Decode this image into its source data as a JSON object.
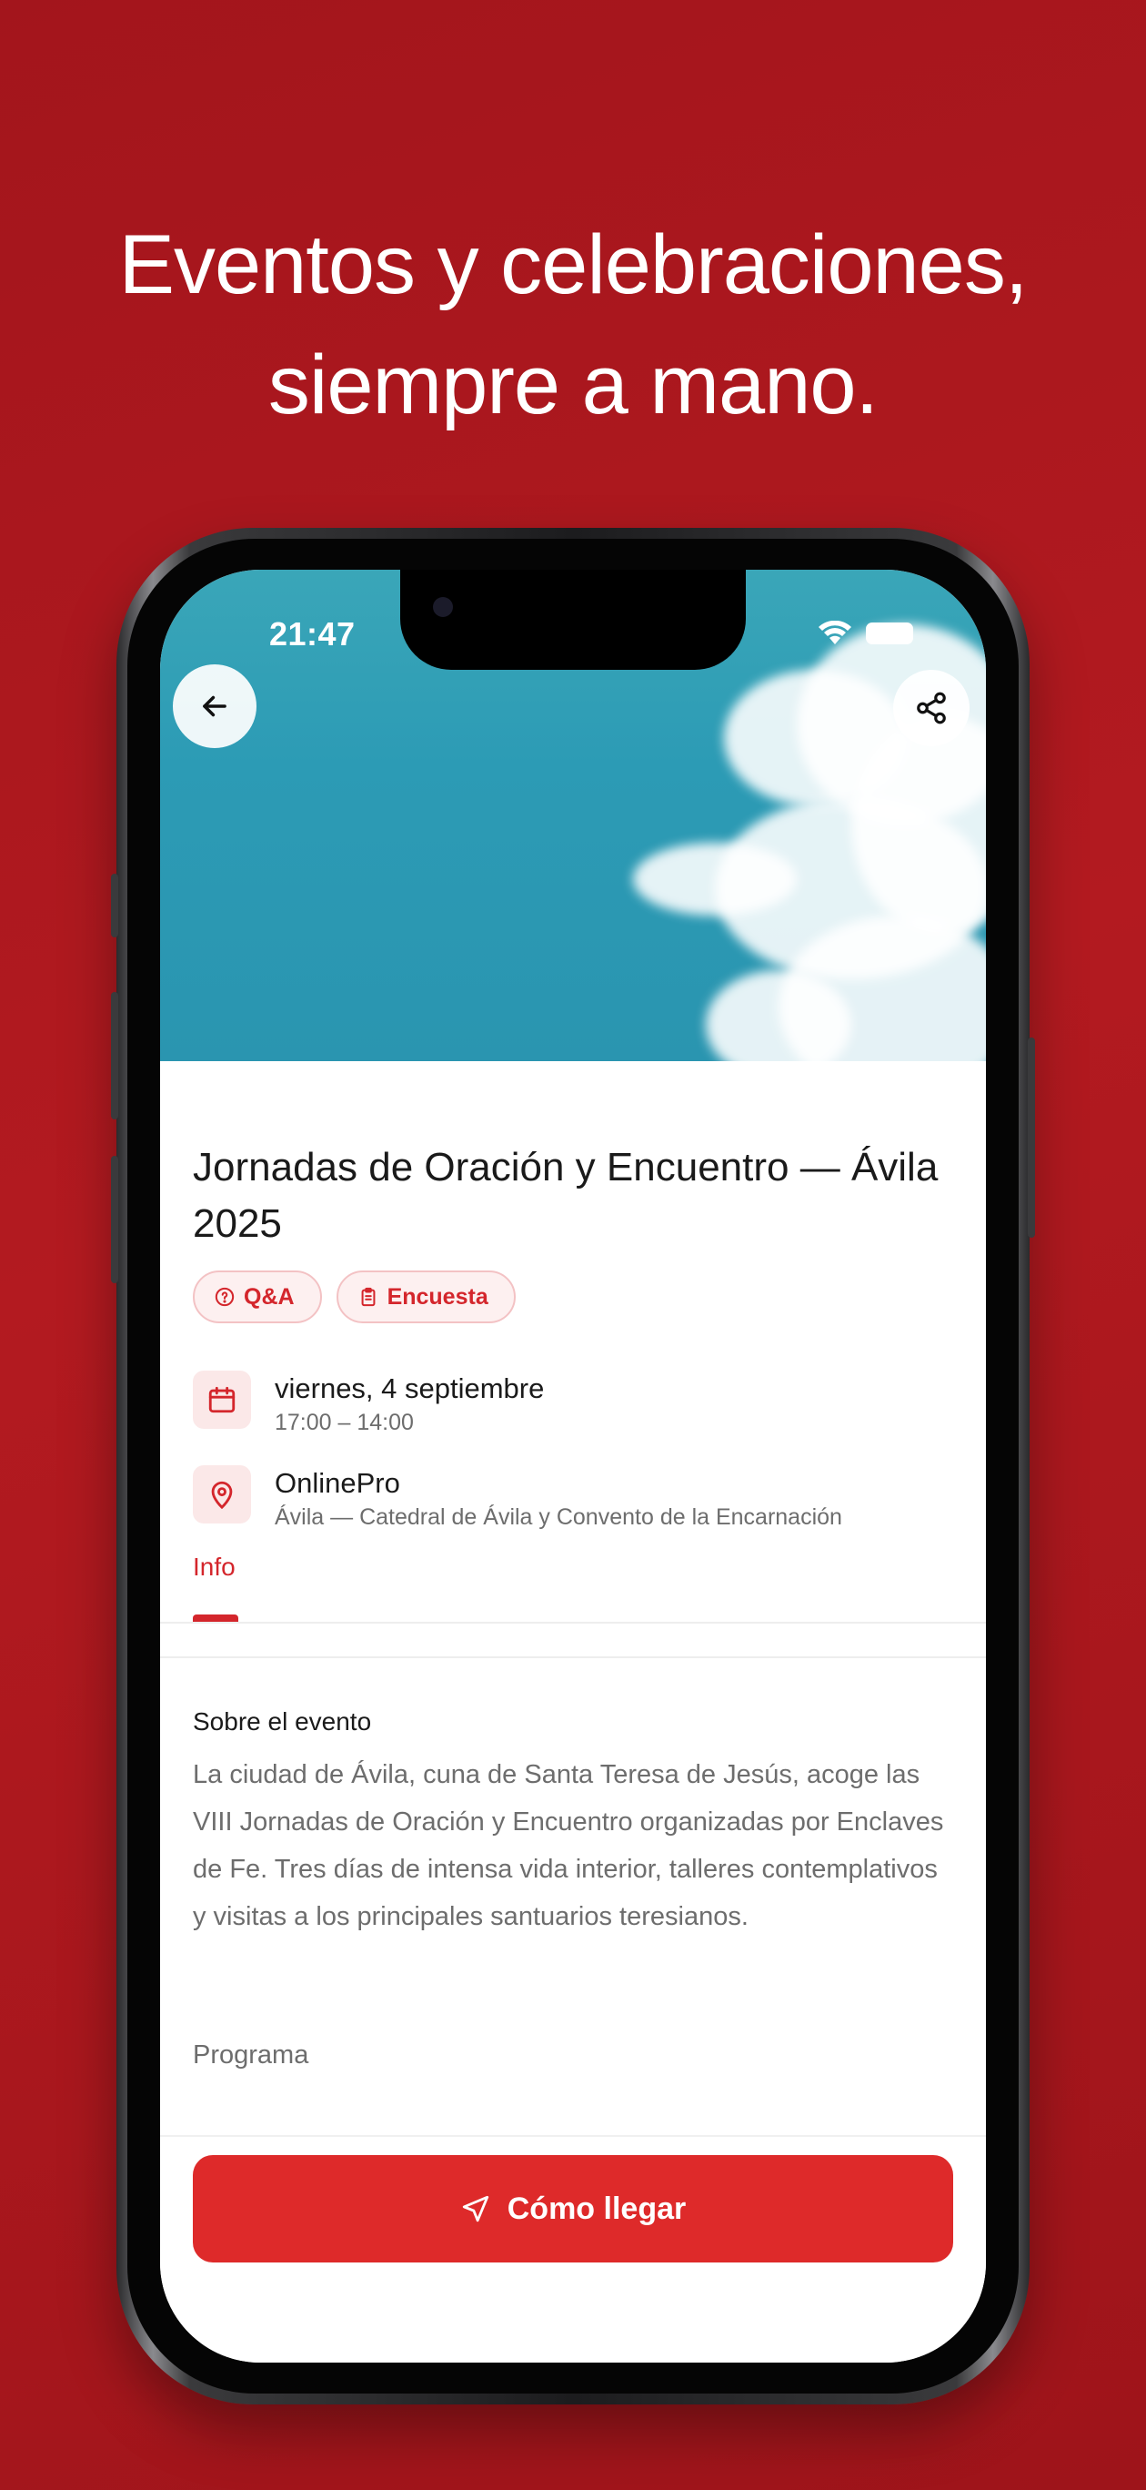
{
  "headline": {
    "line1": "Eventos y celebraciones,",
    "line2": "siempre a mano."
  },
  "status_bar": {
    "time": "21:47"
  },
  "event": {
    "title": "Jornadas de Oración y Encuentro — Ávila 2025",
    "tags": [
      {
        "label": "Q&A",
        "icon": "question-circle-icon"
      },
      {
        "label": "Encuesta",
        "icon": "clipboard-icon"
      }
    ],
    "date": {
      "main": "viernes, 4 septiembre",
      "sub": "17:00 – 14:00",
      "icon": "calendar-icon"
    },
    "location": {
      "main": "OnlinePro",
      "sub": "Ávila — Catedral de Ávila y Convento de la Encarnación",
      "icon": "map-pin-icon"
    }
  },
  "tabs": [
    {
      "label": "Info",
      "active": true
    }
  ],
  "about": {
    "title": "Sobre el evento",
    "description": "La ciudad de Ávila, cuna de Santa Teresa de Jesús, acoge las VIII Jornadas de Oración y Encuentro organizadas por Enclaves de Fe. Tres días de intensa vida interior, talleres contemplativos y visitas a los principales santuarios teresianos.",
    "program_heading": "Programa"
  },
  "cta": {
    "label": "Cómo llegar",
    "icon": "navigation-arrow-icon"
  },
  "colors": {
    "brand_red": "#de2a2a",
    "background_red": "#a3151c",
    "accent_text": "#d4262c"
  }
}
